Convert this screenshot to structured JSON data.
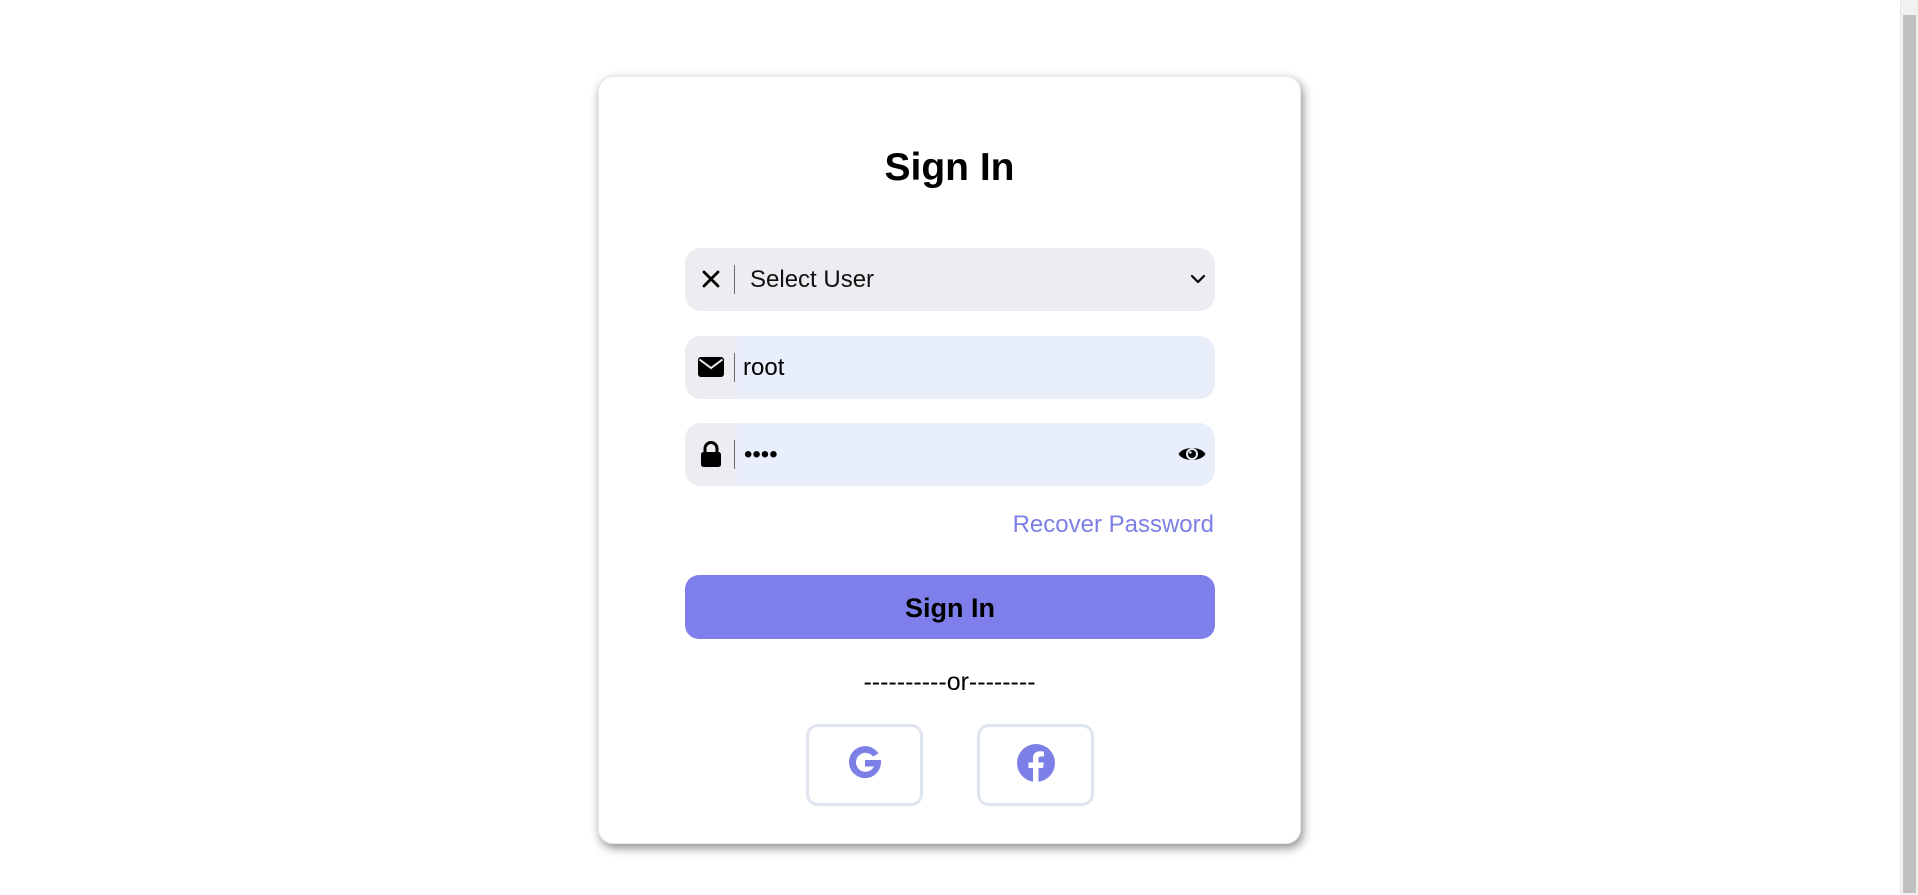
{
  "login": {
    "title": "Sign In",
    "user_select": {
      "selected": "Select User",
      "clear_icon": "close-icon",
      "dropdown_icon": "chevron-down-icon"
    },
    "email": {
      "value": "root",
      "icon": "envelope-icon"
    },
    "password": {
      "masked_value": "••••",
      "icon": "lock-icon",
      "toggle_icon": "eye-icon"
    },
    "recover_link": "Recover Password",
    "submit_label": "Sign In",
    "separator": "----------or--------",
    "social": [
      {
        "name": "google",
        "icon": "google-icon"
      },
      {
        "name": "facebook",
        "icon": "facebook-icon"
      }
    ]
  },
  "colors": {
    "accent": "#7e7fea",
    "link": "#7b7fe6",
    "field_bg": "#ebedf0",
    "input_bg": "#e8eefa",
    "social_border": "#dee5ef"
  }
}
